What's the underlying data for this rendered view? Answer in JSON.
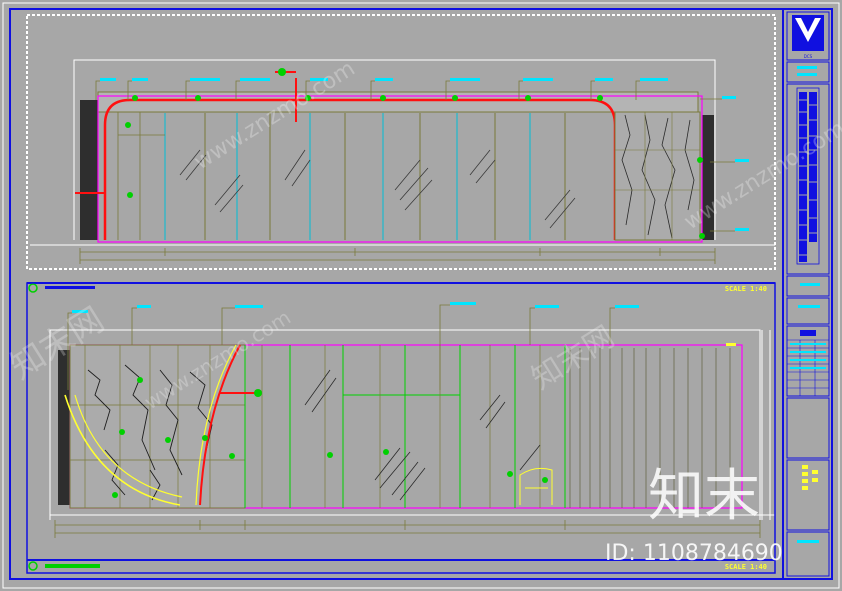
{
  "drawing": {
    "top_panel": {
      "scale": "SCALE 1:40"
    },
    "bottom_panel": {
      "scale": "SCALE 1:40"
    }
  },
  "title_block": {
    "logo_caption": "DCS"
  },
  "watermarks": {
    "site": "www.znzmo.com",
    "brand": "知末网",
    "large_brand": "知末",
    "id_label": "ID: 1108784690"
  },
  "colors": {
    "background": "#a7a7a7",
    "frame": "#1010e0",
    "annotation": "#00e5ff",
    "dimension": "#7a7a3a",
    "magenta": "#ff00ff",
    "green": "#00d000",
    "red": "#ff1010",
    "yellow": "#ffff30",
    "dark_wall": "#2e2e2e"
  }
}
